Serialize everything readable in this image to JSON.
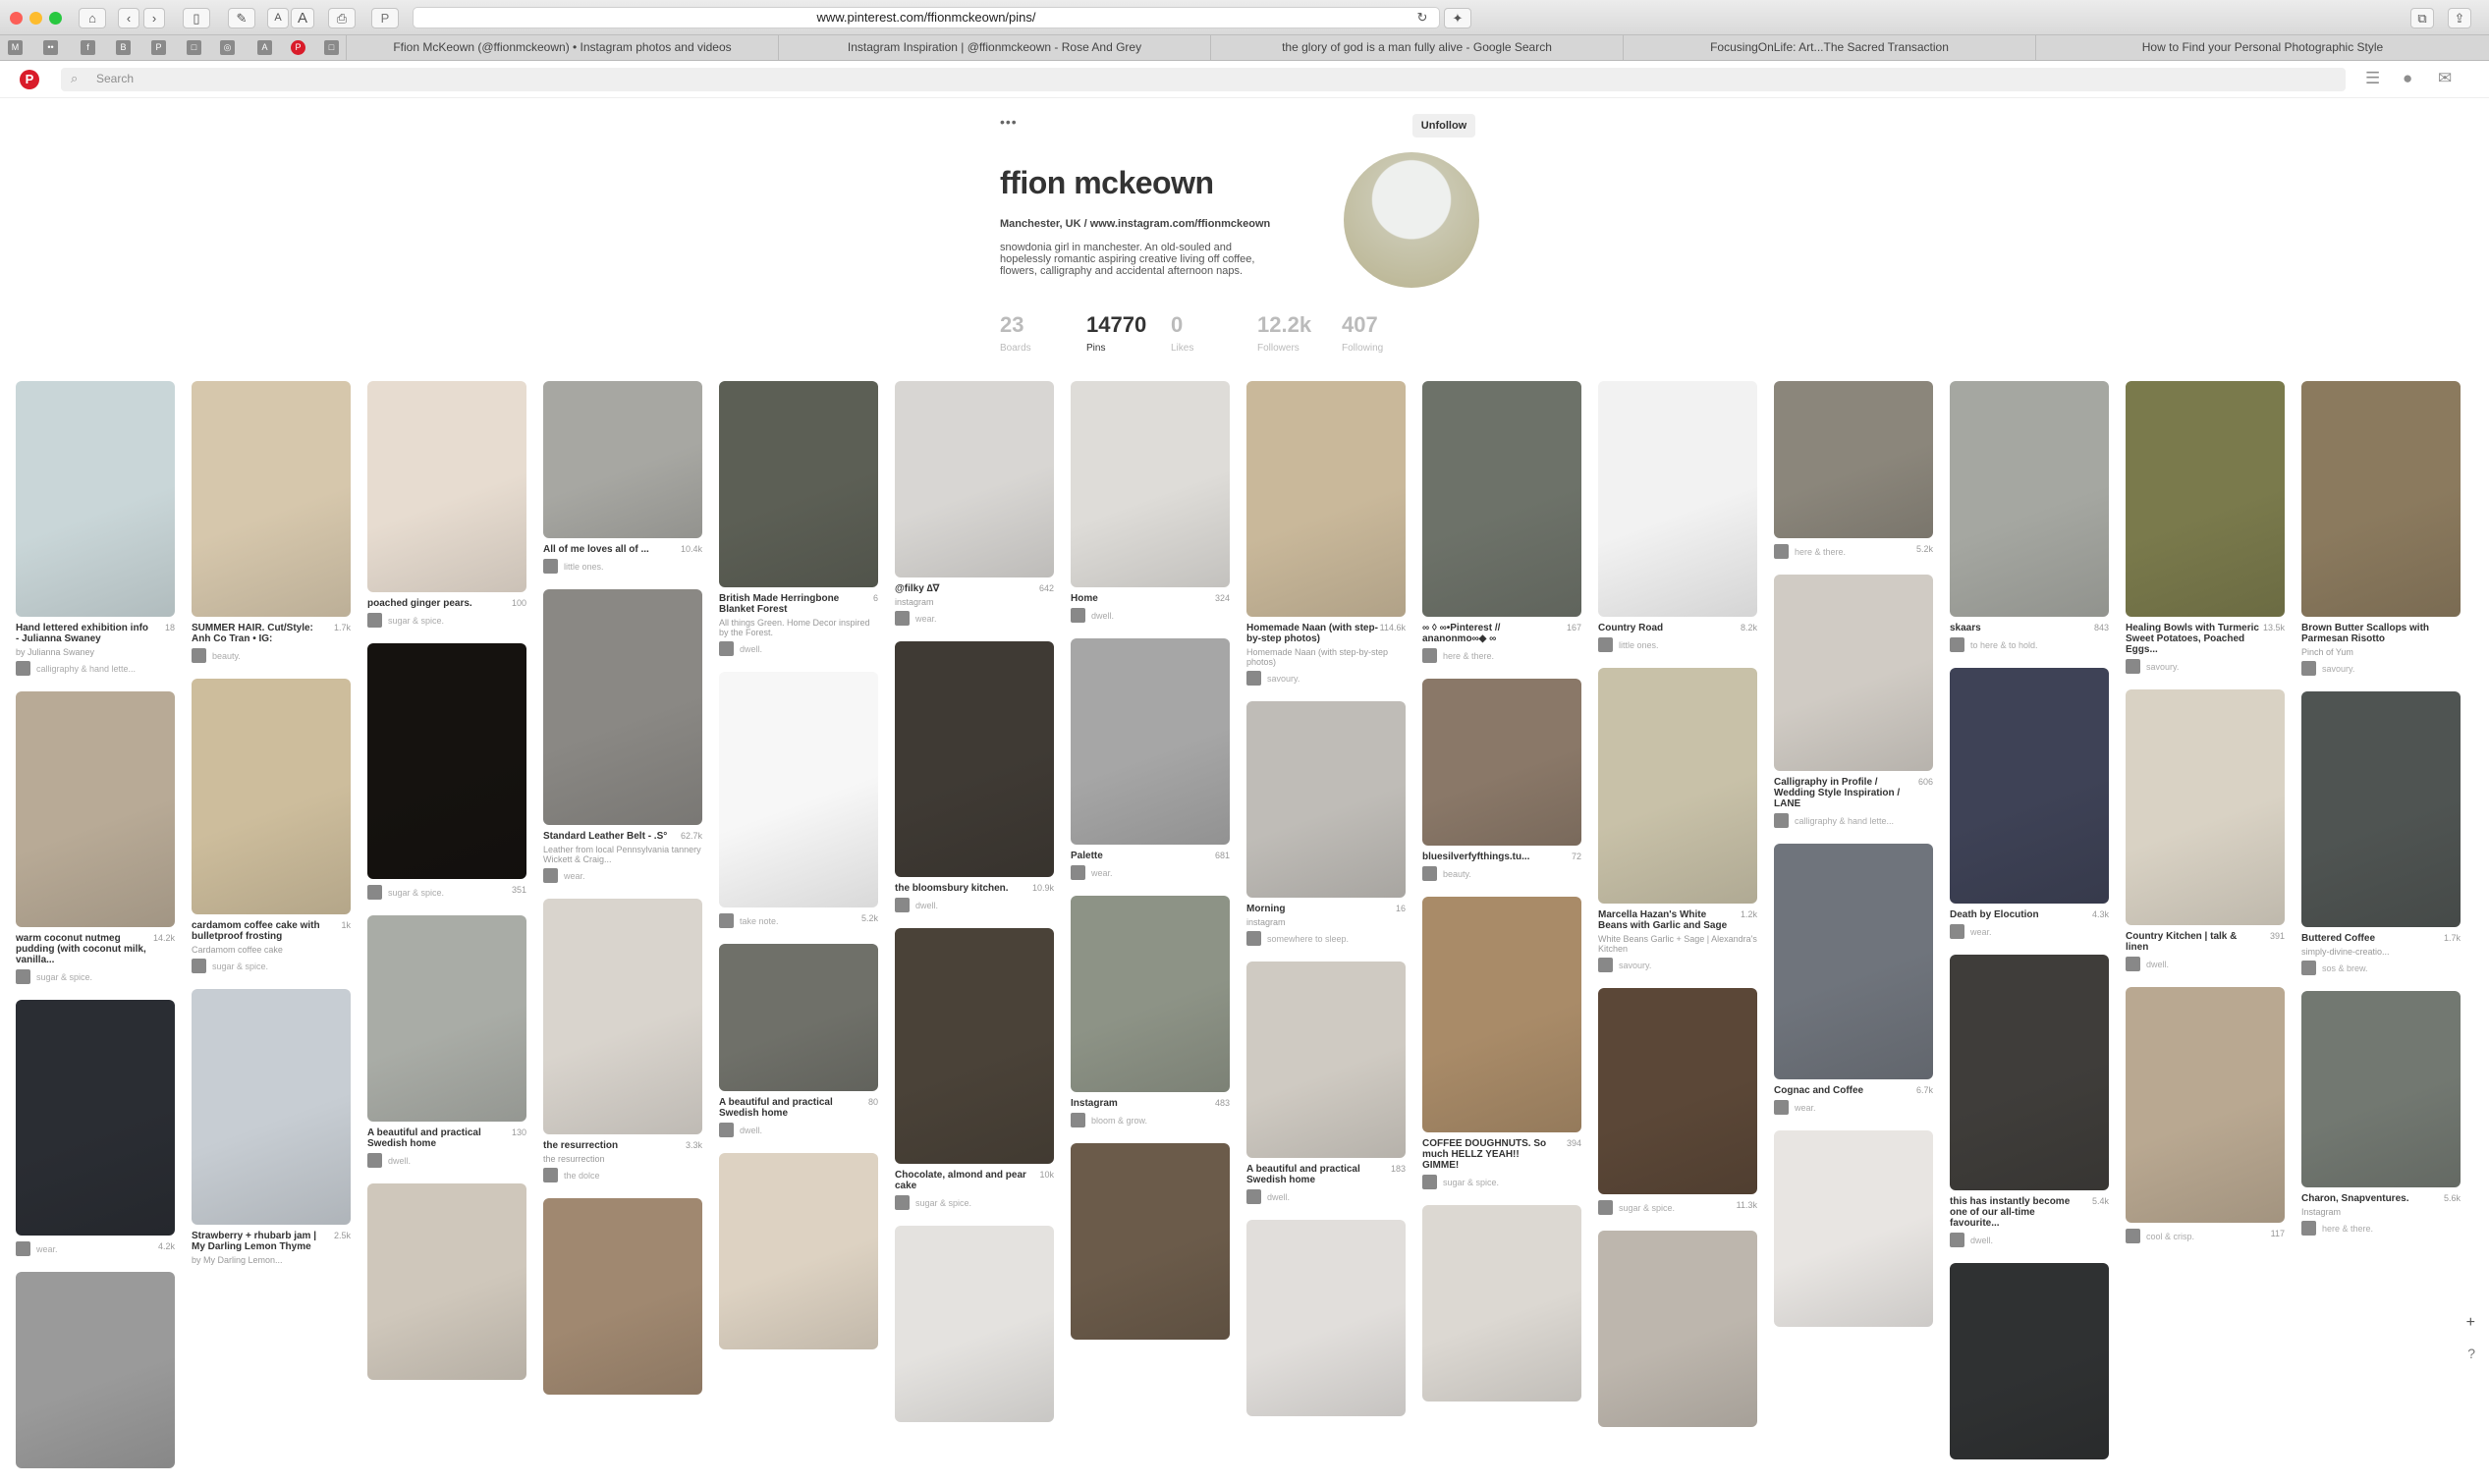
{
  "browser": {
    "url": "www.pinterest.com/ffionmckeown/pins/",
    "tabs": [
      "Ffion McKeown (@ffionmckeown) • Instagram photos and videos",
      "Instagram Inspiration | @ffionmckeown - Rose And Grey",
      "the glory of god is a man fully alive - Google Search",
      "FocusingOnLife: Art...The Sacred Transaction",
      "How to Find your Personal Photographic Style"
    ],
    "font_small": "A",
    "font_large": "A"
  },
  "header": {
    "search_placeholder": "Search"
  },
  "profile": {
    "more": "•••",
    "unfollow": "Unfollow",
    "name": "ffion mckeown",
    "location": "Manchester, UK / www.instagram.com/ffionmckeown",
    "bio": "snowdonia girl in manchester. An old-souled and hopelessly romantic aspiring creative living off coffee, flowers, calligraphy and accidental afternoon naps.",
    "stats": [
      {
        "n": "23",
        "l": "Boards"
      },
      {
        "n": "14770",
        "l": "Pins"
      },
      {
        "n": "0",
        "l": "Likes"
      },
      {
        "n": "12.2k",
        "l": "Followers"
      },
      {
        "n": "407",
        "l": "Following"
      }
    ]
  },
  "columns": [
    [
      {
        "c": "#c9d6d8",
        "t": "Hand lettered exhibition info - Julianna Swaney",
        "r": "18",
        "s": "by Julianna Swaney",
        "b": "calligraphy & hand lette..."
      },
      {
        "c": "#b8aa96",
        "t": "warm coconut nutmeg pudding (with coconut milk, vanilla...",
        "r": "14.2k",
        "s": "",
        "b": "sugar & spice."
      },
      {
        "c": "#2a2d33",
        "t": "",
        "r": "4.2k",
        "s": "",
        "b": "wear."
      },
      {
        "c": "#9a9a9a",
        "t": "",
        "r": "",
        "s": "",
        "b": ""
      }
    ],
    [
      {
        "c": "#d6c7ac",
        "t": "SUMMER HAIR. Cut/Style: Anh Co Tran • IG:",
        "r": "1.7k",
        "s": "",
        "b": "beauty."
      },
      {
        "c": "#cdbd9c",
        "t": "cardamom coffee cake with bulletproof frosting",
        "r": "1k",
        "s": "Cardamom coffee cake",
        "b": "sugar & spice."
      },
      {
        "c": "#c7cdd3",
        "t": "Strawberry + rhubarb jam | My Darling Lemon Thyme",
        "r": "2.5k",
        "s": "by My Darling Lemon...",
        "b": ""
      }
    ],
    [
      {
        "c": "#e7dcd0",
        "t": "poached ginger pears.",
        "r": "100",
        "s": "",
        "b": "sugar & spice."
      },
      {
        "c": "#15120f",
        "t": "",
        "r": "351",
        "s": "",
        "b": "sugar & spice."
      },
      {
        "c": "#a9aca6",
        "t": "A beautiful and practical Swedish home",
        "r": "130",
        "s": "",
        "b": "dwell."
      },
      {
        "c": "#cfc7bb",
        "t": "",
        "r": "",
        "s": "",
        "b": ""
      }
    ],
    [
      {
        "c": "#a7a7a2",
        "t": "All of me loves all of ...",
        "r": "10.4k",
        "s": "",
        "b": "little ones."
      },
      {
        "c": "#8a8884",
        "t": "Standard Leather Belt - .S°",
        "r": "62.7k",
        "s": "Leather from local Pennsylvania tannery Wickett & Craig...",
        "b": "wear."
      },
      {
        "c": "#d9d4cd",
        "t": "the resurrection",
        "r": "3.3k",
        "s": "the resurrection",
        "b": "the dolce"
      },
      {
        "c": "#a08870",
        "t": "",
        "r": "",
        "s": "",
        "b": ""
      }
    ],
    [
      {
        "c": "#5c5f55",
        "t": "British Made Herringbone Blanket Forest",
        "r": "6",
        "s": "All things Green. Home Decor inspired by the Forest.",
        "b": "dwell."
      },
      {
        "c": "#f7f7f7",
        "t": "",
        "r": "5.2k",
        "s": "",
        "b": "take note."
      },
      {
        "c": "#6f7069",
        "t": "A beautiful and practical Swedish home",
        "r": "80",
        "s": "",
        "b": "dwell."
      },
      {
        "c": "#ddd2c2",
        "t": "",
        "r": "",
        "s": "",
        "b": ""
      }
    ],
    [
      {
        "c": "#d8d6d3",
        "t": "@filky ∆∇",
        "r": "642",
        "s": "instagram",
        "b": "wear."
      },
      {
        "c": "#3f3a34",
        "t": "the bloomsbury kitchen.",
        "r": "10.9k",
        "s": "",
        "b": "dwell."
      },
      {
        "c": "#4a4238",
        "t": "Chocolate, almond and pear cake",
        "r": "10k",
        "s": "",
        "b": "sugar & spice."
      },
      {
        "c": "#e4e2df",
        "t": "",
        "r": "",
        "s": "",
        "b": ""
      }
    ],
    [
      {
        "c": "#dedcd8",
        "t": "Home",
        "r": "324",
        "s": "",
        "b": "dwell."
      },
      {
        "c": "#a6a6a6",
        "t": "Palette",
        "r": "681",
        "s": "",
        "b": "wear."
      },
      {
        "c": "#8d9386",
        "t": "Instagram",
        "r": "483",
        "s": "",
        "b": "bloom & grow."
      },
      {
        "c": "#6b5b4a",
        "t": "",
        "r": "",
        "s": "",
        "b": ""
      }
    ],
    [
      {
        "c": "#c9b89a",
        "t": "Homemade Naan (with step-by-step photos)",
        "r": "114.6k",
        "s": "Homemade Naan (with step-by-step photos)",
        "b": "savoury."
      },
      {
        "c": "#bfbcb7",
        "t": "Morning",
        "r": "16",
        "s": "instagram",
        "b": "somewhere to sleep."
      },
      {
        "c": "#cfcac2",
        "t": "A beautiful and practical Swedish home",
        "r": "183",
        "s": "",
        "b": "dwell."
      },
      {
        "c": "#e1dedb",
        "t": "",
        "r": "",
        "s": "",
        "b": ""
      }
    ],
    [
      {
        "c": "#6d7269",
        "t": "∞ ◊ ∞•Pinterest // ananonmo∞◆ ∞",
        "r": "167",
        "s": "",
        "b": "here & there."
      },
      {
        "c": "#8a7868",
        "t": "bluesilverfyfthings.tu...",
        "r": "72",
        "s": "",
        "b": "beauty."
      },
      {
        "c": "#a98b68",
        "t": "COFFEE DOUGHNUTS. So much HELLZ YEAH!! GIMME!",
        "r": "394",
        "s": "",
        "b": "sugar & spice."
      },
      {
        "c": "#dcd8d2",
        "t": "",
        "r": "",
        "s": "",
        "b": ""
      }
    ],
    [
      {
        "c": "#f2f2f2",
        "t": "Country Road",
        "r": "8.2k",
        "s": "",
        "b": "little ones."
      },
      {
        "c": "#c8c1a8",
        "t": "Marcella Hazan's White Beans with Garlic and Sage",
        "r": "1.2k",
        "s": "White Beans Garlic + Sage | Alexandra's Kitchen",
        "b": "savoury."
      },
      {
        "c": "#5b4737",
        "t": "",
        "r": "11.3k",
        "s": "",
        "b": "sugar & spice."
      },
      {
        "c": "#bdb6ad",
        "t": "",
        "r": "",
        "s": "",
        "b": ""
      }
    ],
    [
      {
        "c": "#8b867b",
        "t": "",
        "r": "5.2k",
        "s": "",
        "b": "here & there."
      },
      {
        "c": "#d0cbc4",
        "t": "Calligraphy in Profile / Wedding Style Inspiration / LANE",
        "r": "606",
        "s": "",
        "b": "calligraphy & hand lette..."
      },
      {
        "c": "#6f747c",
        "t": "Cognac and Coffee",
        "r": "6.7k",
        "s": "",
        "b": "wear."
      },
      {
        "c": "#e8e5e2",
        "t": "",
        "r": "",
        "s": "",
        "b": ""
      }
    ],
    [
      {
        "c": "#a5a7a1",
        "t": "skaars",
        "r": "843",
        "s": "",
        "b": "to here & to hold."
      },
      {
        "c": "#3e4256",
        "t": "Death by Elocution",
        "r": "4.3k",
        "s": "",
        "b": "wear."
      },
      {
        "c": "#3f3d3a",
        "t": "this has instantly become one of our all-time favourite...",
        "r": "5.4k",
        "s": "",
        "b": "dwell."
      },
      {
        "c": "#2f3132",
        "t": "",
        "r": "",
        "s": "",
        "b": ""
      }
    ],
    [
      {
        "c": "#7a7a4c",
        "t": "Healing Bowls with Turmeric Sweet Potatoes, Poached Eggs...",
        "r": "13.5k",
        "s": "",
        "b": "savoury."
      },
      {
        "c": "#d9d2c4",
        "t": "Country Kitchen | talk & linen",
        "r": "391",
        "s": "",
        "b": "dwell."
      },
      {
        "c": "#b9a891",
        "t": "",
        "r": "117",
        "s": "",
        "b": "cool & crisp."
      }
    ],
    [
      {
        "c": "#8b7a5e",
        "t": "Brown Butter Scallops with Parmesan Risotto",
        "r": "",
        "s": "Pinch of Yum",
        "b": "savoury."
      },
      {
        "c": "#4f5452",
        "t": "Buttered Coffee",
        "r": "1.7k",
        "s": "simply-divine-creatio...",
        "b": "sos & brew."
      },
      {
        "c": "#727871",
        "t": "Charon, Snapventures.",
        "r": "5.6k",
        "s": "Instagram",
        "b": "here & there."
      }
    ]
  ]
}
